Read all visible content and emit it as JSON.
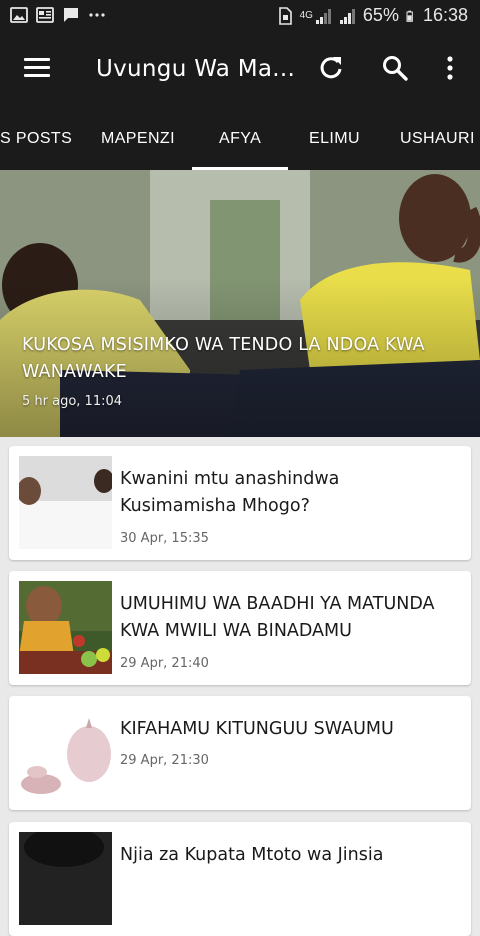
{
  "status_bar": {
    "network": "4G",
    "battery": "65%",
    "time": "16:38"
  },
  "app_bar": {
    "title": "Uvungu Wa Ma..."
  },
  "tabs": [
    {
      "label": "S POSTS"
    },
    {
      "label": "MAPENZI"
    },
    {
      "label": "AFYA",
      "selected": true
    },
    {
      "label": "ELIMU"
    },
    {
      "label": "USHAURI"
    }
  ],
  "featured": {
    "title": "KUKOSA MSISIMKO WA TENDO LA NDOA KWA WANAWAKE",
    "time": "5 hr ago, 11:04"
  },
  "articles": [
    {
      "title": "Kwanini mtu anashindwa Kusimamisha Mhogo?",
      "time": "30 Apr, 15:35"
    },
    {
      "title": "UMUHIMU WA BAADHI YA MATUNDA KWA MWILI WA BINADAMU",
      "time": "29 Apr, 21:40"
    },
    {
      "title": "KIFAHAMU KITUNGUU SWAUMU",
      "time": "29 Apr, 21:30"
    },
    {
      "title": "Njia za Kupata Mtoto wa Jinsia",
      "time": ""
    }
  ],
  "colors": {
    "app_bar": "#1b1b1b",
    "background": "#e9e9e9",
    "card": "#ffffff"
  }
}
